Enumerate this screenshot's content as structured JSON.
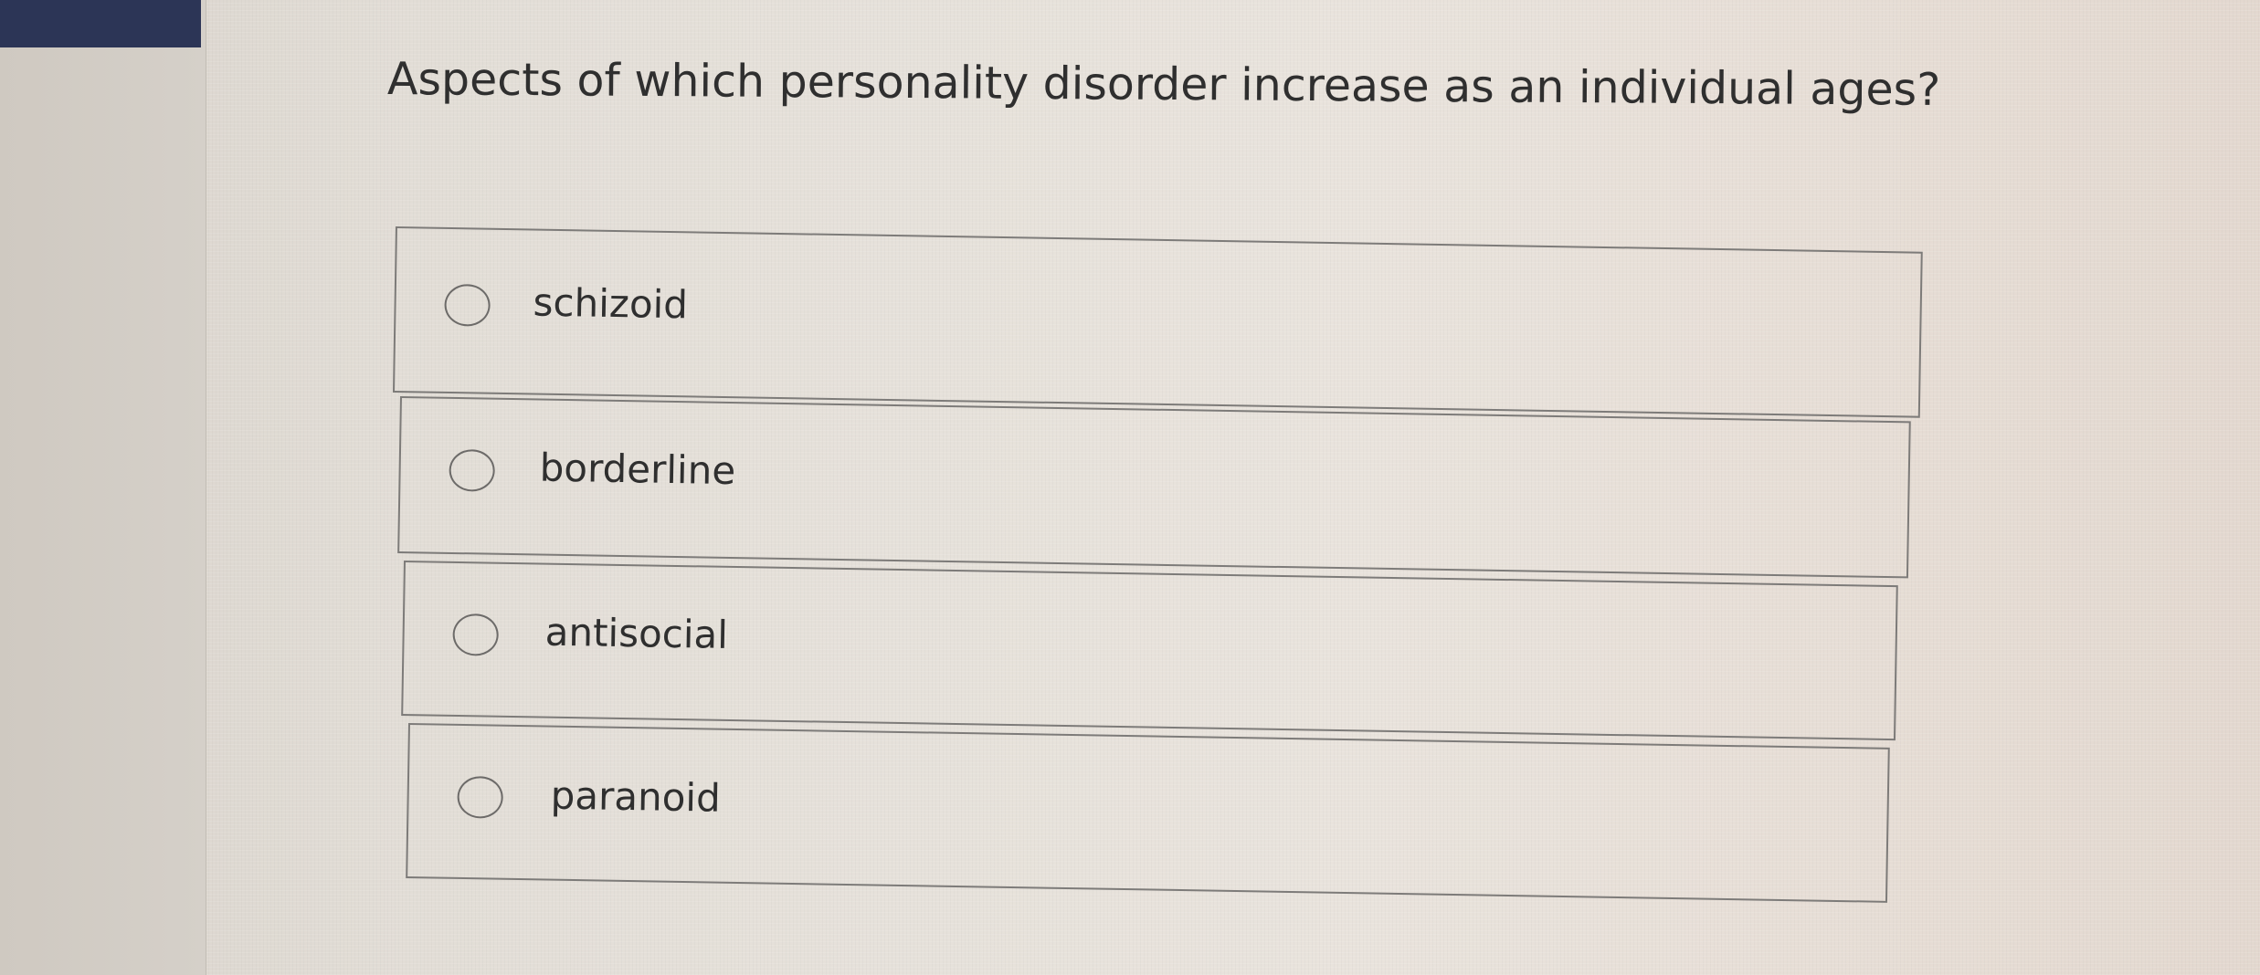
{
  "question": {
    "text": "Aspects of which personality disorder increase as an individual ages?"
  },
  "options": [
    {
      "label": "schizoid",
      "selected": false
    },
    {
      "label": "borderline",
      "selected": false
    },
    {
      "label": "antisocial",
      "selected": false
    },
    {
      "label": "paranoid",
      "selected": false
    }
  ],
  "colors": {
    "nav": "#2c3556",
    "background": "#e6e1da",
    "text": "#2f2f2f",
    "border": "#7d7b79"
  }
}
